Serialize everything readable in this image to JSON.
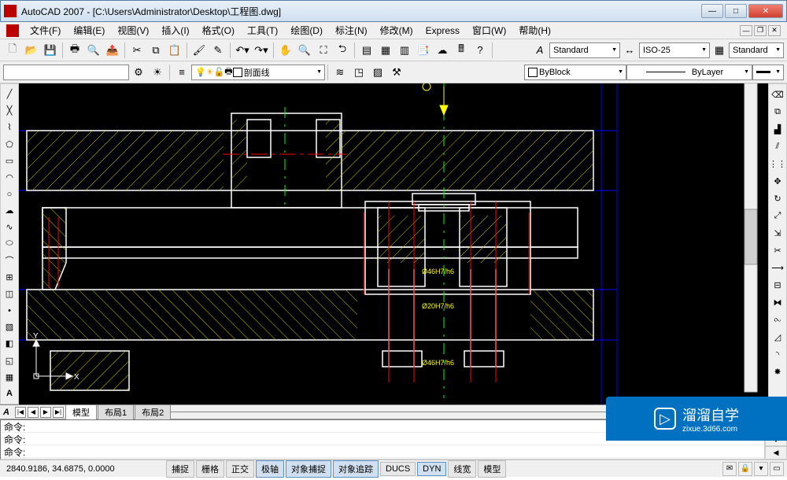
{
  "window": {
    "title": "AutoCAD 2007 - [C:\\Users\\Administrator\\Desktop\\工程图.dwg]"
  },
  "menubar": {
    "items": [
      "文件(F)",
      "编辑(E)",
      "视图(V)",
      "插入(I)",
      "格式(O)",
      "工具(T)",
      "绘图(D)",
      "标注(N)",
      "修改(M)",
      "Express",
      "窗口(W)",
      "帮助(H)"
    ]
  },
  "toolbar1": {
    "icons": [
      "new",
      "open",
      "save",
      "sep",
      "plot",
      "preview",
      "publish",
      "sep",
      "cut",
      "copy",
      "paste",
      "sep",
      "match",
      "sep",
      "undo-drop",
      "redo-drop",
      "sep",
      "pan",
      "zoom-rt",
      "zoom-win",
      "zoom-prev",
      "sep",
      "properties",
      "designcenter",
      "toolpalettes",
      "sheetset",
      "markup",
      "calc",
      "sep"
    ],
    "text_style_label": "Standard",
    "dim_style_label": "ISO-25",
    "table_style_label": "Standard"
  },
  "toolbar2": {
    "layer_input": "",
    "layer_icons": [
      "layerprops",
      "layerprev"
    ],
    "layer_state_icons": [
      "on",
      "freeze",
      "lock",
      "color",
      "clip"
    ],
    "current_layer": "剖面线",
    "color_label": "ByBlock",
    "linetype_label": "ByLayer"
  },
  "left_tools": [
    "line",
    "xline",
    "pline",
    "polygon",
    "rect",
    "arc",
    "circle",
    "revcloud",
    "spline",
    "ellipse",
    "ellipse-arc",
    "insert",
    "block",
    "point",
    "hatch",
    "gradient",
    "region",
    "table",
    "mtext",
    "A"
  ],
  "right_tools": [
    "dist",
    "area",
    "erase",
    "copy",
    "mirror",
    "offset",
    "array",
    "move",
    "rotate",
    "scale",
    "stretch",
    "trim",
    "extend",
    "break-pt",
    "break",
    "join",
    "chamfer",
    "fillet",
    "explode"
  ],
  "layout_tabs": {
    "nav": [
      "|◀",
      "◀",
      "▶",
      "▶|"
    ],
    "tabs": [
      "模型",
      "布局1",
      "布局2"
    ],
    "active": 0
  },
  "command": {
    "prompt": "命令:",
    "lines": [
      "命令:",
      "命令:"
    ]
  },
  "statusbar": {
    "coords": "2840.9186, 34.6875, 0.0000",
    "toggles": [
      "捕捉",
      "栅格",
      "正交",
      "极轴",
      "对象捕捉",
      "对象追踪",
      "DUCS",
      "DYN",
      "线宽",
      "模型"
    ],
    "active_toggles": [
      3,
      4,
      5,
      7
    ]
  },
  "drawing": {
    "annotations": [
      "Ø46H7/h6",
      "Ø20H7/h6",
      "Ø46H7/h6"
    ],
    "ucs_label_x": "X",
    "ucs_label_y": "Y"
  },
  "watermark": {
    "brand": "溜溜自学",
    "url": "zixue.3d66.com"
  }
}
